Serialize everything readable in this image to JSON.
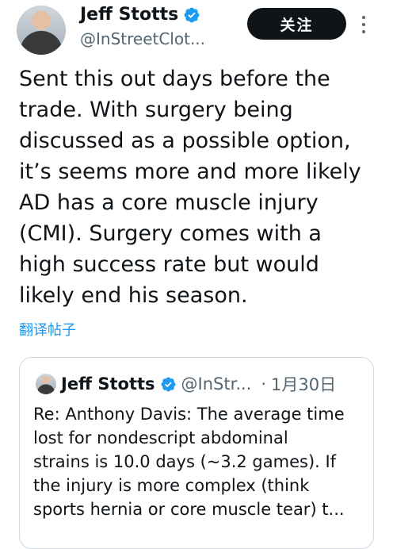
{
  "author": {
    "name": "Jeff Stotts",
    "handle": "@InStreetClot..."
  },
  "follow_label": "关注",
  "tweet_text": "Sent this out days before the\ntrade. With surgery being\ndiscussed as a possible option,\nit’s seems more and more likely\nAD has a core muscle injury\n(CMI). Surgery comes with a\nhigh success rate but would\nlikely end his season.",
  "translate_label": "翻译帖子",
  "quote": {
    "name": "Jeff Stotts",
    "handle": "@InStr...",
    "separator": "·",
    "date": "1月30日",
    "text": "Re: Anthony Davis: The average time\nlost for nondescript abdominal\nstrains is 10.0 days (~3.2 games). If\nthe injury is more complex (think\nsports hernia or core muscle tear) t..."
  },
  "colors": {
    "verified": "#1d9bf0",
    "link": "#1d9bf0",
    "follow_bg": "#0f1419"
  },
  "icons": {
    "verified": "verified-badge-icon",
    "more": "more-options-icon"
  }
}
